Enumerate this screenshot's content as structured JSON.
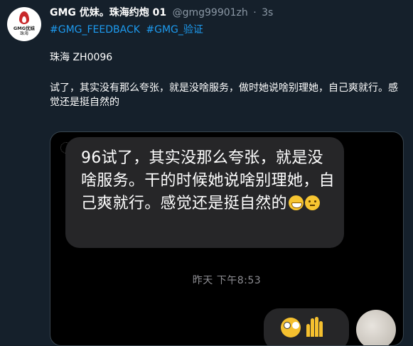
{
  "tweet": {
    "display_name": "GMG 优妹。珠海约炮 01",
    "handle": "@gmg99901zh",
    "separator": "·",
    "time": "3s",
    "avatar_text_line1": "GMG优妹",
    "avatar_text_line2": "珠海",
    "hashtags": [
      "#GMG_FEEDBACK",
      "#GMG_验证"
    ],
    "line1": "珠海 ZH0096",
    "body_text": "试了，其实没有那么夸张，就是没啥服务，做时她说啥别理她，自己爽就行。感觉还是挺自然的"
  },
  "media": {
    "message_text": "96试了，其实没那么夸张，就是没啥服务。干的时候她说啥别理她，自己爽就行。感觉还是挺自然的",
    "message_emojis": [
      "grinning-face",
      "thinking-face"
    ],
    "timestamp": "昨天 下午8:53",
    "reply_emojis": [
      "face-with-wide-eyes",
      "hand"
    ]
  },
  "colors": {
    "background": "#15202b",
    "link": "#1d9bf0",
    "secondary_text": "#8b98a5",
    "bubble": "#262628"
  }
}
